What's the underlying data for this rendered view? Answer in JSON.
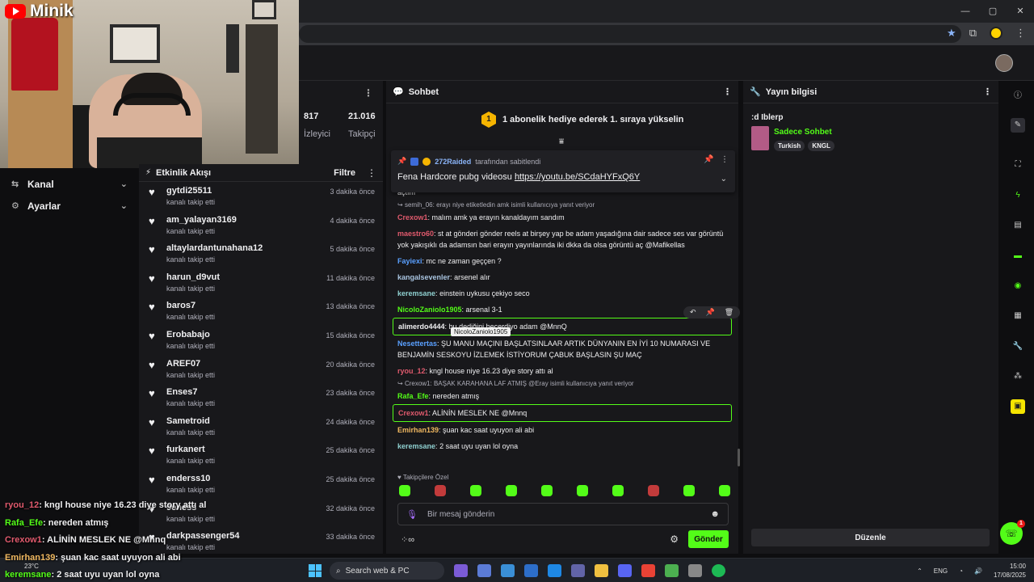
{
  "browser": {
    "window_controls": [
      "—",
      "▢",
      "✕"
    ]
  },
  "logo": {
    "text": "Minik"
  },
  "nav": {
    "items": [
      {
        "label": "Kanal"
      },
      {
        "label": "Ayarlar"
      }
    ]
  },
  "stats": [
    {
      "value": "817",
      "label": "İzleyici"
    },
    {
      "value": "21.016",
      "label": "Takipçi"
    }
  ],
  "feed": {
    "title": "Etkinlik Akışı",
    "filter": "Filtre",
    "items": [
      {
        "name": "gytdi25511",
        "action": "kanalı takip etti",
        "time": "3 dakika önce"
      },
      {
        "name": "am_yalayan3169",
        "action": "kanalı takip etti",
        "time": "4 dakika önce"
      },
      {
        "name": "altaylardantunahana12",
        "action": "kanalı takip etti",
        "time": "5 dakika önce"
      },
      {
        "name": "harun_d9vut",
        "action": "kanalı takip etti",
        "time": "11 dakika önce"
      },
      {
        "name": "baros7",
        "action": "kanalı takip etti",
        "time": "13 dakika önce"
      },
      {
        "name": "Erobabajo",
        "action": "kanalı takip etti",
        "time": "15 dakika önce"
      },
      {
        "name": "AREF07",
        "action": "kanalı takip etti",
        "time": "20 dakika önce"
      },
      {
        "name": "Enses7",
        "action": "kanalı takip etti",
        "time": "23 dakika önce"
      },
      {
        "name": "Sametroid",
        "action": "kanalı takip etti",
        "time": "24 dakika önce"
      },
      {
        "name": "furkanert",
        "action": "kanalı takip etti",
        "time": "25 dakika önce"
      },
      {
        "name": "enderss10",
        "action": "kanalı takip etti",
        "time": "25 dakika önce"
      },
      {
        "name": "9eness",
        "action": "kanalı takip etti",
        "time": "32 dakika önce"
      },
      {
        "name": "darkpassenger54",
        "action": "kanalı takip etti",
        "time": "33 dakika önce"
      }
    ]
  },
  "chat": {
    "title": "Sohbet",
    "promo": "1 abonelik hediye ederek 1. sıraya yükselin",
    "promo_badge": "1",
    "pinned": {
      "user": "272Raided",
      "by": "tarafından sabitlendi",
      "text": "Fena Hardcore pubg videosu ",
      "link": "https://youtu.be/SCdaHYFxQ6Y"
    },
    "messages": [
      {
        "type": "msg",
        "user": "",
        "color": "#efeff1",
        "text": "açtım"
      },
      {
        "type": "reply",
        "text": "semih_06: erayı niye etiketledin amk isimli kullanıcıya yanıt veriyor"
      },
      {
        "type": "msg",
        "user": "Crexow1",
        "color": "#e05a6d",
        "text": "malım amk ya erayın kanaldayım sandım"
      },
      {
        "type": "msg",
        "user": "maestro60",
        "color": "#e05a6d",
        "text": "st at gönderi gönder reels at birşey yap be adam yaşadığına dair sadece ses var görüntü yok yakışıklı da adamsın bari erayın yayınlarında iki dkka da olsa görüntü aç @Mafikellas"
      },
      {
        "type": "msg",
        "user": "Fayiexi",
        "color": "#5aa0ff",
        "text": "mc ne zaman geççen ?"
      },
      {
        "type": "msg",
        "user": "kangalsevenler",
        "color": "#a9c4e0",
        "text": "arsenel alır"
      },
      {
        "type": "msg",
        "user": "keremsane",
        "color": "#8fd0d0",
        "text": "einstein uykusu çekiyo seco"
      },
      {
        "type": "msg",
        "user": "NicoloZaniolo1905",
        "color": "#53fc18",
        "text": "arsenal 3-1"
      },
      {
        "type": "msg",
        "user": "alimerdo4444",
        "color": "#efeff1",
        "text": "bu dediğini becerdiyo adam @MnnQ",
        "hl": true
      },
      {
        "type": "msg",
        "user": "Nesettertas",
        "color": "#5aa0ff",
        "text": "ŞU MANU MAÇINI BAŞLATSINLAAR ARTIK DÜNYANIN EN İYİ 10 NUMARASI VE BENJAMİN SESKOYU İZLEMEK İSTİYORUM ÇABUK BAŞLASIN ŞU MAÇ"
      },
      {
        "type": "msg",
        "user": "ryou_12",
        "color": "#e05a6d",
        "text": "kngl house niye 16.23 diye story attı al"
      },
      {
        "type": "reply",
        "text": "Crexow1: BAŞAK KARAHANA LAF ATMIŞ @Eray isimli kullanıcıya yanıt veriyor"
      },
      {
        "type": "msg",
        "user": "Rafa_Efe",
        "color": "#53fc18",
        "text": "nereden atmış"
      },
      {
        "type": "msg",
        "user": "Crexow1",
        "color": "#e05a6d",
        "text": "ALİNİN MESLEK NE @Mnnq",
        "hl": true
      },
      {
        "type": "msg",
        "user": "Emirhan139",
        "color": "#f0b860",
        "text": "şuan kac saat uyuyon ali abi"
      },
      {
        "type": "msg",
        "user": "keremsane",
        "color": "#8fd0d0",
        "text": "2 saat uyu uyan lol oyna"
      }
    ],
    "tooltip": "NicoloZaniolo1905",
    "followers_only": "Takipçilere Özel",
    "input_placeholder": "Bir mesaj gönderin",
    "send_label": "Gönder"
  },
  "info": {
    "title": "Yayın bilgisi",
    "stream_title": ":d Iblerp",
    "category": "Sadece Sohbet",
    "tags": [
      "Turkish",
      "KNGL"
    ],
    "edit_label": "Düzenle"
  },
  "help_badge": "1",
  "overlay": [
    {
      "user": "ryou_12",
      "color": "#e05a6d",
      "text": ": kngl house niye 16.23 diye story attı al"
    },
    {
      "user": "Rafa_Efe",
      "color": "#53fc18",
      "text": ": nereden atmış"
    },
    {
      "user": "Crexow1",
      "color": "#e05a6d",
      "text": ": ALİNİN MESLEK NE @Mnnq"
    },
    {
      "user": "Emirhan139",
      "color": "#f0b860",
      "text": ": şuan kac saat uyuyon ali abi"
    },
    {
      "user": "keremsane",
      "color": "#53fc18",
      "text": ": 2 saat uyu uyan lol oyna"
    }
  ],
  "taskbar": {
    "weather": "23°C",
    "search_placeholder": "Search web & PC",
    "lang": "ENG",
    "time": "15:00",
    "date": "17/08/2025"
  }
}
